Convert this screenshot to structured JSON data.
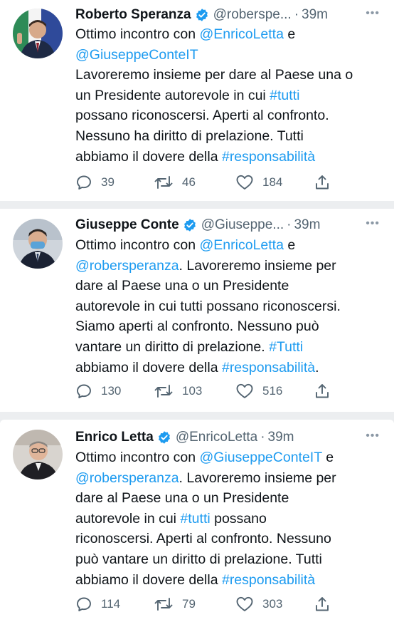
{
  "tweets": [
    {
      "name": "Roberto Speranza",
      "handle": "@roberspe...",
      "time": "39m",
      "text": [
        {
          "t": "Ottimo incontro con ",
          "link": false
        },
        {
          "t": "@EnricoLetta",
          "link": true
        },
        {
          "t": " e ",
          "link": false
        },
        {
          "t": "@GiuseppeConteIT",
          "link": true
        },
        {
          "t": "\nLavoreremo insieme per dare al Paese una o\nun Presidente autorevole in cui ",
          "link": false
        },
        {
          "t": "#tutti",
          "link": true
        },
        {
          "t": "\npossano riconoscersi. Aperti al confronto.\nNessuno ha diritto di prelazione. Tutti\nabbiamo il dovere della ",
          "link": false
        },
        {
          "t": "#responsabilità",
          "link": true
        }
      ],
      "replies": "39",
      "retweets": "46",
      "likes": "184"
    },
    {
      "name": "Giuseppe Conte",
      "handle": "@Giuseppe...",
      "time": "39m",
      "text": [
        {
          "t": "Ottimo incontro con ",
          "link": false
        },
        {
          "t": "@EnricoLetta",
          "link": true
        },
        {
          "t": " e\n",
          "link": false
        },
        {
          "t": "@robersperanza",
          "link": true
        },
        {
          "t": ". Lavoreremo insieme per\ndare al Paese una o un Presidente\nautorevole in cui tutti possano riconoscersi.\nSiamo aperti al confronto. Nessuno può\nvantare un diritto di prelazione. ",
          "link": false
        },
        {
          "t": "#Tutti",
          "link": true
        },
        {
          "t": "\nabbiamo il dovere della ",
          "link": false
        },
        {
          "t": "#responsabilità",
          "link": true
        },
        {
          "t": ".",
          "link": false
        }
      ],
      "replies": "130",
      "retweets": "103",
      "likes": "516"
    },
    {
      "name": "Enrico Letta",
      "handle": "@EnricoLetta",
      "time": "39m",
      "text": [
        {
          "t": "Ottimo incontro con ",
          "link": false
        },
        {
          "t": "@GiuseppeConteIT",
          "link": true
        },
        {
          "t": " e\n",
          "link": false
        },
        {
          "t": "@robersperanza",
          "link": true
        },
        {
          "t": ". Lavoreremo insieme per\ndare al Paese una o un Presidente\nautorevole in cui ",
          "link": false
        },
        {
          "t": "#tutti",
          "link": true
        },
        {
          "t": " possano\nriconoscersi. Aperti al confronto. Nessuno\npuò vantare un diritto di prelazione. Tutti\nabbiamo il dovere della ",
          "link": false
        },
        {
          "t": "#responsabilità",
          "link": true
        }
      ],
      "replies": "114",
      "retweets": "79",
      "likes": "303"
    }
  ],
  "ui": {
    "dot_separator": "·",
    "more_glyph": "•••",
    "accent_color": "#1d9bf0",
    "muted_color": "#536471",
    "icons": [
      "verified-badge-icon",
      "reply-icon",
      "retweet-icon",
      "like-icon",
      "share-icon",
      "more-options-icon"
    ]
  }
}
